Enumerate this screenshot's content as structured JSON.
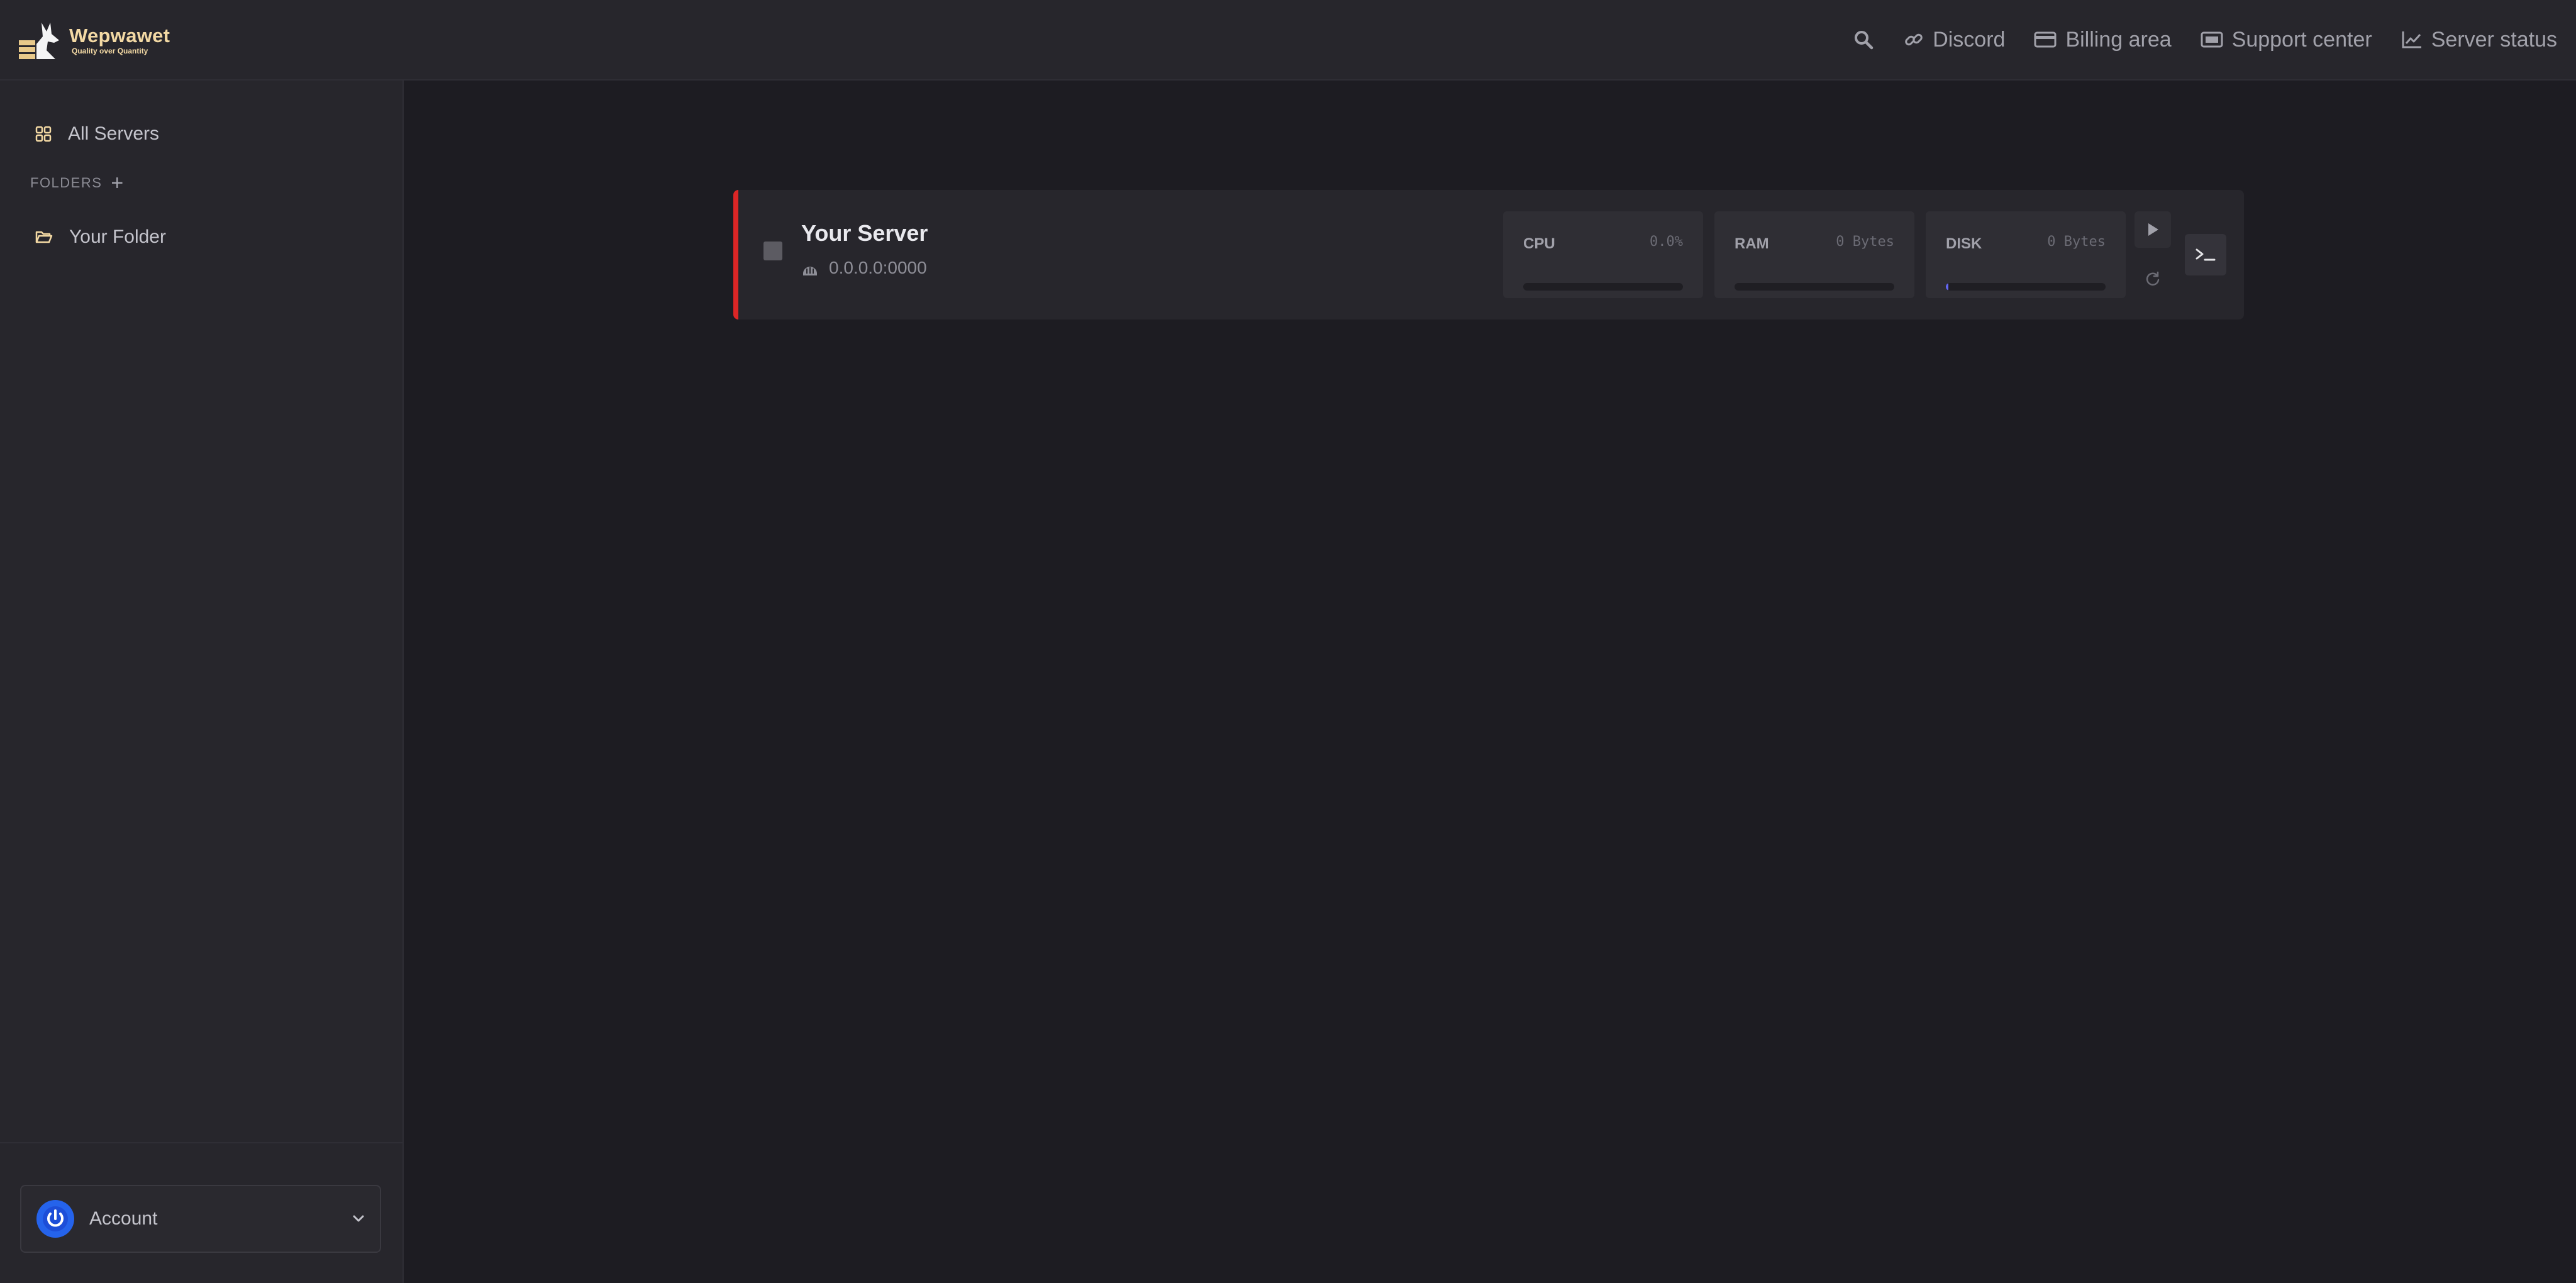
{
  "brand": {
    "name": "Wepwawet",
    "tagline": "Quality over Quantity",
    "accent": "#f3d9a4"
  },
  "topnav": {
    "search_icon": "search-icon",
    "items": [
      {
        "label": "Discord",
        "icon": "link-icon"
      },
      {
        "label": "Billing area",
        "icon": "credit-card-icon"
      },
      {
        "label": "Support center",
        "icon": "ticket-icon"
      },
      {
        "label": "Server status",
        "icon": "chart-line-icon"
      }
    ]
  },
  "sidebar": {
    "all_servers": "All Servers",
    "folders_label": "FOLDERS",
    "folders_add": "+",
    "folders": [
      {
        "label": "Your Folder"
      }
    ],
    "account_label": "Account"
  },
  "server": {
    "name": "Your Server",
    "address": "0.0.0.0:0000",
    "status_color": "#dc2626",
    "stats": [
      {
        "label": "CPU",
        "value": "0.0%",
        "fill": 0
      },
      {
        "label": "RAM",
        "value": "0 Bytes",
        "fill": 0
      },
      {
        "label": "DISK",
        "value": "0 Bytes",
        "fill": 0.01
      }
    ]
  }
}
